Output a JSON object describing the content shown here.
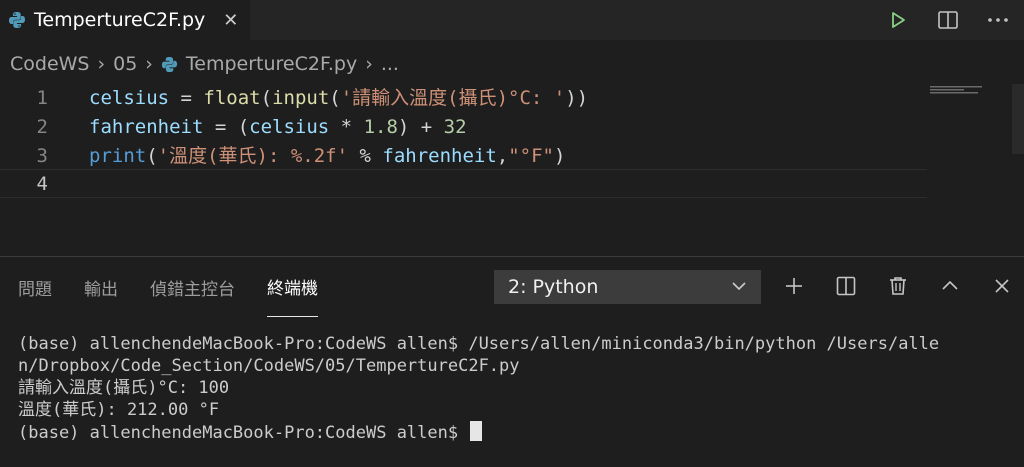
{
  "tab": {
    "title": "TempertureC2F.py"
  },
  "breadcrumb": {
    "items": [
      "CodeWS",
      "05",
      "TempertureC2F.py",
      "..."
    ]
  },
  "editor": {
    "line_numbers": [
      "1",
      "2",
      "3",
      "4"
    ],
    "lines": [
      [
        [
          "var",
          "celsius"
        ],
        [
          "plain",
          " = "
        ],
        [
          "fn",
          "float"
        ],
        [
          "plain",
          "("
        ],
        [
          "fn",
          "input"
        ],
        [
          "plain",
          "("
        ],
        [
          "str",
          "'請輸入溫度(攝氏)°C: '"
        ],
        [
          "plain",
          "))"
        ]
      ],
      [
        [
          "var",
          "fahrenheit"
        ],
        [
          "plain",
          " = ("
        ],
        [
          "var",
          "celsius"
        ],
        [
          "plain",
          " * "
        ],
        [
          "num",
          "1.8"
        ],
        [
          "plain",
          ") + "
        ],
        [
          "num",
          "32"
        ]
      ],
      [
        [
          "kw",
          "print"
        ],
        [
          "plain",
          "("
        ],
        [
          "str",
          "'溫度(華氏): %.2f'"
        ],
        [
          "plain",
          " % "
        ],
        [
          "var",
          "fahrenheit"
        ],
        [
          "plain",
          ","
        ],
        [
          "str",
          "\"°F\""
        ],
        [
          "plain",
          ")"
        ]
      ],
      []
    ]
  },
  "panel": {
    "tabs": [
      "問題",
      "輸出",
      "偵錯主控台",
      "終端機"
    ],
    "active_tab": 3,
    "terminal_select": "2: Python",
    "terminal_lines": [
      "(base) allenchendeMacBook-Pro:CodeWS allen$ /Users/allen/miniconda3/bin/python /Users/alle",
      "n/Dropbox/Code_Section/CodeWS/05/TempertureC2F.py",
      "請輸入溫度(攝氏)°C: 100",
      "溫度(華氏): 212.00 °F"
    ],
    "prompt": "(base) allenchendeMacBook-Pro:CodeWS allen$ "
  },
  "colors": {
    "accent_run": "#89d185",
    "python_icon": "#519aba"
  }
}
